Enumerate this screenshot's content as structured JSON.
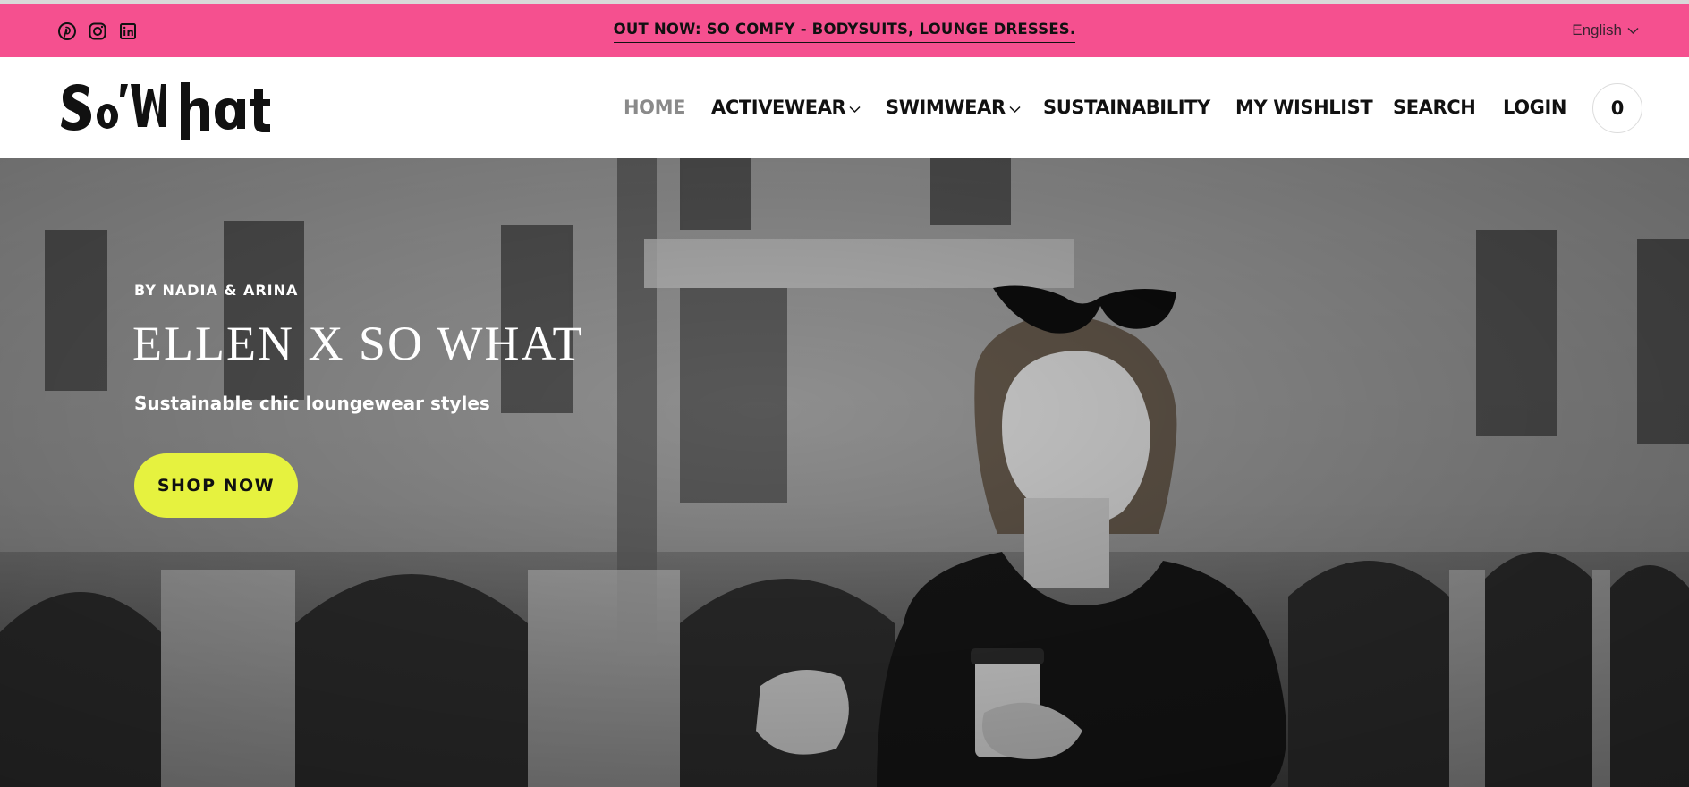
{
  "colors": {
    "announcement_bg": "#f5508f",
    "cta_bg": "#e6f23f",
    "nav_active": "#8a8a8a",
    "text_dark": "#111111"
  },
  "announcement": {
    "message": "OUT NOW: SO COMFY - BODYSUITS, LOUNGE DRESSES.",
    "social_icons": [
      "pinterest-icon",
      "instagram-icon",
      "linkedin-icon"
    ],
    "language": "English"
  },
  "header": {
    "logo_text": "SoWhat",
    "nav": [
      {
        "label": "HOME",
        "active": true,
        "has_dropdown": false
      },
      {
        "label": "ACTIVEWEAR",
        "active": false,
        "has_dropdown": true
      },
      {
        "label": "SWIMWEAR",
        "active": false,
        "has_dropdown": true
      },
      {
        "label": "SUSTAINABILITY",
        "active": false,
        "has_dropdown": false
      },
      {
        "label": "MY WISHLIST",
        "active": false,
        "has_dropdown": false
      },
      {
        "label": "SEARCH",
        "active": false,
        "has_dropdown": false
      },
      {
        "label": "LOGIN",
        "active": false,
        "has_dropdown": false
      }
    ],
    "cart_count": "0"
  },
  "hero": {
    "kicker": "BY NADIA & ARINA",
    "title": "ELLEN X SO WHAT",
    "subtitle": "Sustainable chic loungewear styles",
    "cta": "SHOP NOW"
  }
}
